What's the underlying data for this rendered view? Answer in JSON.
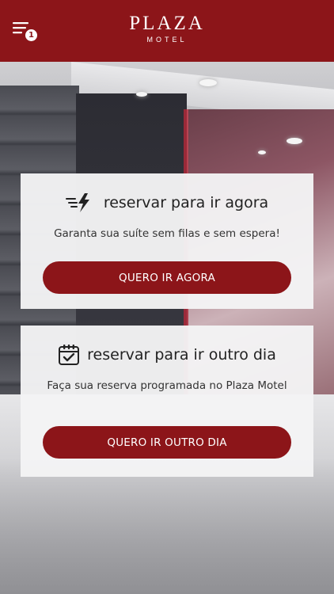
{
  "header": {
    "brand": "PLAZA",
    "brand_sub": "MOTEL",
    "menu_icon": "hamburger-menu-icon",
    "notification_count": "1"
  },
  "cards": [
    {
      "icon": "fast-lightning-icon",
      "title": "reservar para ir agora",
      "description": "Garanta sua suíte sem filas e sem espera!",
      "button_label": "QUERO IR AGORA"
    },
    {
      "icon": "calendar-check-icon",
      "title": "reservar para ir outro dia",
      "description": "Faça sua reserva programada no Plaza Motel",
      "button_label": "QUERO IR OUTRO DIA"
    }
  ],
  "colors": {
    "brand_red": "#8c1519",
    "card_bg": "#f4f4f5",
    "text_dark": "#222222"
  }
}
